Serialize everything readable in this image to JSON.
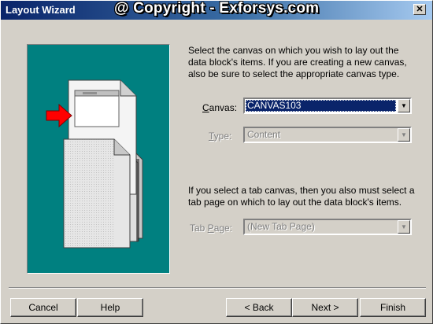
{
  "window": {
    "title": "Layout Wizard",
    "watermark": "@ Copyright - Exforsys.com",
    "close_glyph": "✕"
  },
  "canvas_section": {
    "description": "Select the canvas on which you wish to lay out the data block's items. If you are creating a new canvas, also be sure to select the appropriate canvas type.",
    "canvas_label": "Canvas:",
    "canvas_label_accel": "C",
    "canvas_label_rest": "anvas:",
    "canvas_value": "CANVAS103",
    "type_label_accel": "T",
    "type_label_rest": "ype:",
    "type_value": "Content"
  },
  "tab_section": {
    "description": "If you select a tab canvas, then you also must select a tab page on which to lay out the data block's items.",
    "tab_page_label_start": "Tab ",
    "tab_page_label_accel": "P",
    "tab_page_label_rest": "age:",
    "tab_page_value": "(New Tab Page)"
  },
  "buttons": {
    "cancel": "Cancel",
    "help": "Help",
    "back": "< Back",
    "next": "Next >",
    "finish": "Finish"
  },
  "icons": {
    "dropdown_arrow": "▼"
  },
  "colors": {
    "title_bar": "#0a246a",
    "illustration_bg": "#008080",
    "pointer_arrow": "#ff0000",
    "selection": "#0a246a"
  }
}
